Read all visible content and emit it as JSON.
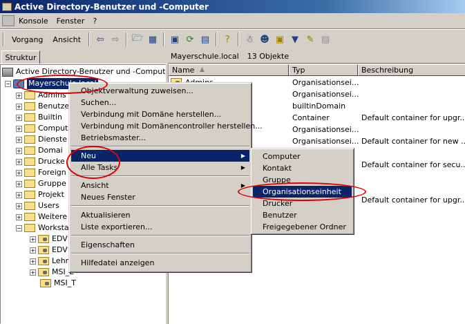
{
  "window": {
    "title": "Active Directory-Benutzer und -Computer"
  },
  "menubar": {
    "items": [
      "Konsole",
      "Fenster",
      "?"
    ]
  },
  "toolbar": {
    "vorgang": "Vorgang",
    "ansicht": "Ansicht"
  },
  "left_pane": {
    "tab": "Struktur",
    "root": "Active Directory-Benutzer und -Computer [m",
    "domain": "Mayerschule.local",
    "items": [
      "Admins",
      "Benutzer",
      "Builtin",
      "Comput",
      "Dienste",
      "Domai",
      "Drucke",
      "Foreign",
      "Gruppe",
      "Projekt",
      "Users",
      "Weitere",
      "Worksta"
    ],
    "sub_items": [
      "EDV",
      "EDV",
      "Lehr",
      "MSI_E",
      "MSI_T"
    ]
  },
  "right_pane": {
    "location": "Mayerschule.local",
    "count": "13 Objekte",
    "columns": [
      "Name",
      "Typ",
      "Beschreibung"
    ],
    "rows": [
      {
        "name": "Admins",
        "typ": "Organisationsei...",
        "beschreibung": ""
      },
      {
        "name": "",
        "typ": "Organisationsei...",
        "beschreibung": ""
      },
      {
        "name": "",
        "typ": "builtinDomain",
        "beschreibung": ""
      },
      {
        "name": "",
        "typ": "Container",
        "beschreibung": "Default container for upgr..."
      },
      {
        "name": "",
        "typ": "Organisationsei...",
        "beschreibung": ""
      },
      {
        "name": "",
        "typ": "Organisationsei...",
        "beschreibung": "Default container for new ..."
      },
      {
        "name": "",
        "typ": "",
        "beschreibung": ""
      },
      {
        "name": "",
        "typ": "",
        "beschreibung": "Default container for secu..."
      },
      {
        "name": "",
        "typ": "",
        "beschreibung": ""
      },
      {
        "name": "",
        "typ": "",
        "beschreibung": ""
      },
      {
        "name": "",
        "typ": "",
        "beschreibung": "Default container for upgr..."
      }
    ]
  },
  "context_menu": {
    "items": [
      "Objektverwaltung zuweisen...",
      "Suchen...",
      "Verbindung mit Domäne herstellen...",
      "Verbindung mit Domänencontroller herstellen...",
      "Betriebsmaster...",
      "Neu",
      "Alle Tasks",
      "Ansicht",
      "Neues Fenster",
      "Aktualisieren",
      "Liste exportieren...",
      "Eigenschaften",
      "Hilfedatei anzeigen"
    ]
  },
  "submenu": {
    "items": [
      "Computer",
      "Kontakt",
      "Gruppe",
      "Organisationseinheit",
      "Drucker",
      "Benutzer",
      "Freigegebener Ordner"
    ]
  },
  "colors": {
    "selection": "#0a246a",
    "annotation": "#e00000"
  }
}
